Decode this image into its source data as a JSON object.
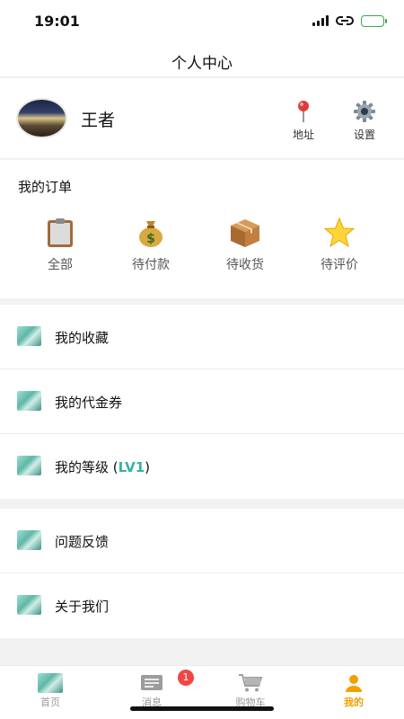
{
  "status_bar": {
    "time": "19:01"
  },
  "nav": {
    "title": "个人中心"
  },
  "profile": {
    "username": "王者",
    "address_label": "地址",
    "settings_label": "设置"
  },
  "orders": {
    "title": "我的订单",
    "items": [
      {
        "label": "全部",
        "icon": "clipboard-icon"
      },
      {
        "label": "待付款",
        "icon": "money-bag-icon"
      },
      {
        "label": "待收货",
        "icon": "package-icon"
      },
      {
        "label": "待评价",
        "icon": "star-icon"
      }
    ]
  },
  "menu_group_1": [
    {
      "label": "我的收藏"
    },
    {
      "label": "我的代金券"
    },
    {
      "label": "我的等级 (",
      "level": "LV1",
      "suffix": ")"
    }
  ],
  "menu_group_2": [
    {
      "label": "问题反馈"
    },
    {
      "label": "关于我们"
    }
  ],
  "tab_bar": {
    "tabs": [
      {
        "label": "首页",
        "icon": "home-icon"
      },
      {
        "label": "消息",
        "icon": "message-icon",
        "badge": "1"
      },
      {
        "label": "购物车",
        "icon": "cart-icon"
      },
      {
        "label": "我的",
        "icon": "user-icon",
        "active": true
      }
    ]
  },
  "colors": {
    "accent": "#f0a000",
    "level": "#33b3a4",
    "badge": "#f24545"
  }
}
